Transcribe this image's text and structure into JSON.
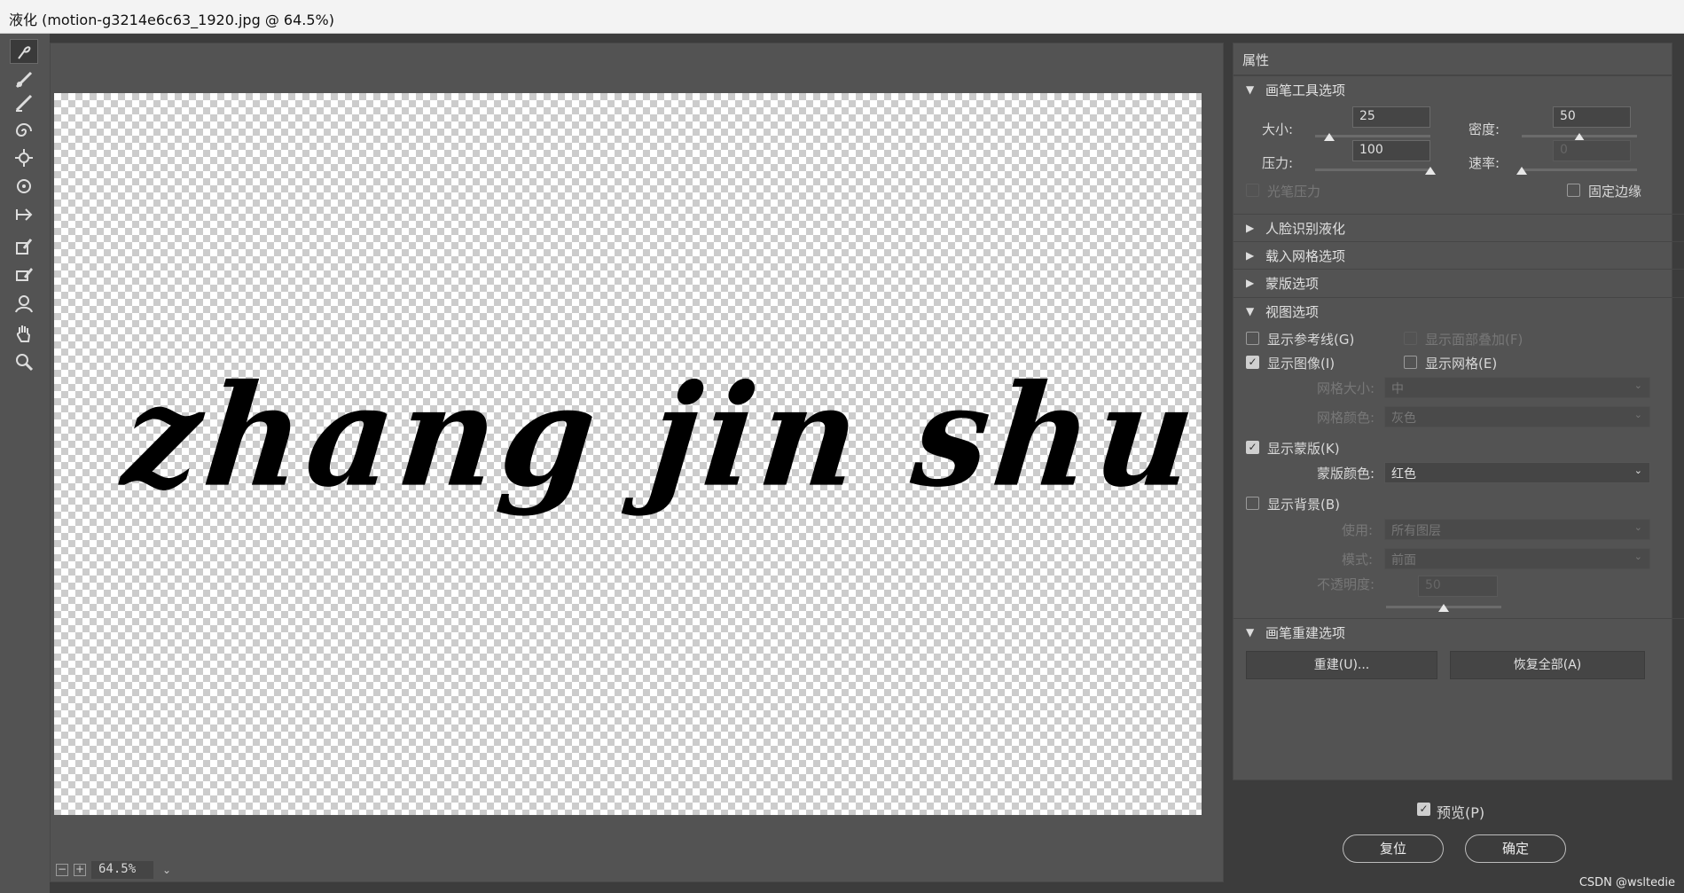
{
  "window": {
    "title": "液化 (motion-g3214e6c63_1920.jpg @ 64.5%)"
  },
  "toolbar": {
    "tools": [
      "forward-warp-tool",
      "reconstruct-tool",
      "smooth-tool",
      "twirl-tool",
      "pucker-tool",
      "bloat-tool",
      "push-left-tool",
      "freeze-mask-tool",
      "thaw-mask-tool",
      "face-tool",
      "hand-tool",
      "zoom-tool"
    ]
  },
  "canvas": {
    "content_text": "zhang jin shu",
    "zoom_value": "64.5%"
  },
  "panel": {
    "title": "属性",
    "brush_tool": {
      "header": "画笔工具选项",
      "size_label": "大小:",
      "size_value": "25",
      "size_fraction": 0.12,
      "density_label": "密度:",
      "density_value": "50",
      "density_fraction": 0.5,
      "pressure_label": "压力:",
      "pressure_value": "100",
      "pressure_fraction": 1.0,
      "rate_label": "速率:",
      "rate_value": "0",
      "rate_fraction": 0.0,
      "stylus_pressure": "光笔压力",
      "pin_edges": "固定边缘"
    },
    "face_aware": {
      "header": "人脸识别液化"
    },
    "load_mesh": {
      "header": "载入网格选项"
    },
    "mask": {
      "header": "蒙版选项"
    },
    "view": {
      "header": "视图选项",
      "show_guides": "显示参考线(G)",
      "show_face_overlay": "显示面部叠加(F)",
      "show_image": "显示图像(I)",
      "show_mesh": "显示网格(E)",
      "mesh_size_label": "网格大小:",
      "mesh_size_value": "中",
      "mesh_color_label": "网格颜色:",
      "mesh_color_value": "灰色",
      "show_mask": "显示蒙版(K)",
      "mask_color_label": "蒙版颜色:",
      "mask_color_value": "红色",
      "show_backdrop": "显示背景(B)",
      "use_label": "使用:",
      "use_value": "所有图层",
      "mode_label": "模式:",
      "mode_value": "前面",
      "opacity_label": "不透明度:",
      "opacity_value": "50",
      "opacity_fraction": 0.5
    },
    "reconstruct": {
      "header": "画笔重建选项",
      "reconstruct_btn": "重建(U)...",
      "restore_all_btn": "恢复全部(A)"
    }
  },
  "footer": {
    "preview_label": "预览(P)",
    "reset_btn": "复位",
    "ok_btn": "确定"
  },
  "watermark": "CSDN @wsltedie",
  "colors": {
    "ui_bg": "#535353",
    "dark_bg": "#3c3c3c",
    "titlebar": "#f3f3f3"
  }
}
